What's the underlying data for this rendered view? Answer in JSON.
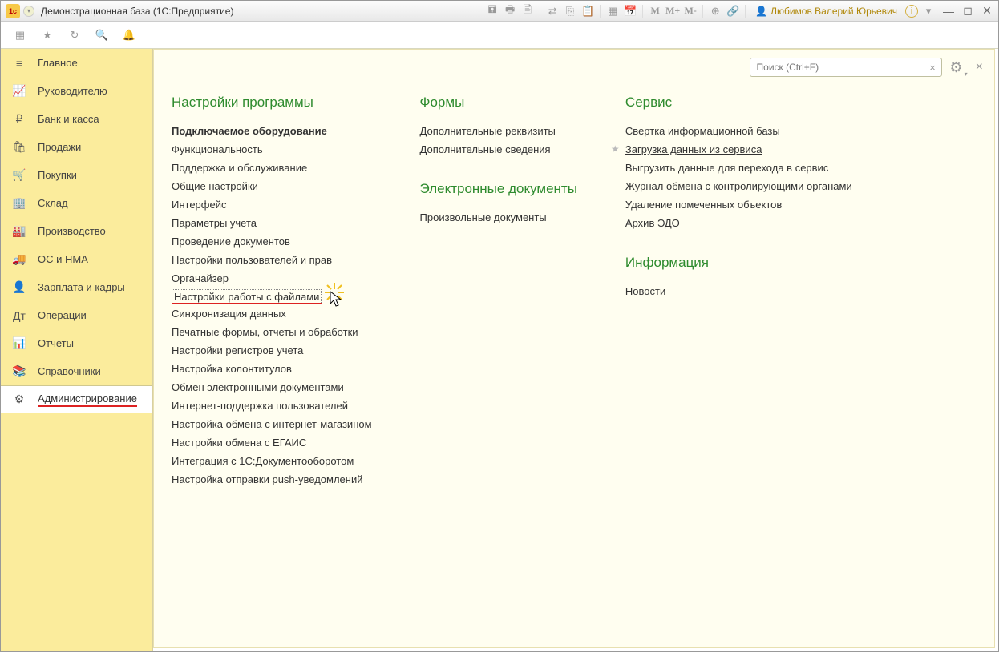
{
  "title": "Демонстрационная база  (1С:Предприятие)",
  "user": "Любимов Валерий Юрьевич",
  "search_placeholder": "Поиск (Ctrl+F)",
  "toolbar": {
    "m1": "M",
    "m2": "M+",
    "m3": "M-"
  },
  "sidebar": {
    "items": [
      {
        "label": "Главное",
        "icon": "≡"
      },
      {
        "label": "Руководителю",
        "icon": "📈"
      },
      {
        "label": "Банк и касса",
        "icon": "₽"
      },
      {
        "label": "Продажи",
        "icon": "🛍"
      },
      {
        "label": "Покупки",
        "icon": "🛒"
      },
      {
        "label": "Склад",
        "icon": "🏢"
      },
      {
        "label": "Производство",
        "icon": "🏭"
      },
      {
        "label": "ОС и НМА",
        "icon": "🚚"
      },
      {
        "label": "Зарплата и кадры",
        "icon": "👤"
      },
      {
        "label": "Операции",
        "icon": "Дт"
      },
      {
        "label": "Отчеты",
        "icon": "📊"
      },
      {
        "label": "Справочники",
        "icon": "📚"
      },
      {
        "label": "Администрирование",
        "icon": "⚙"
      }
    ],
    "active_index": 12
  },
  "columns": [
    {
      "heading": "Настройки программы",
      "items": [
        {
          "label": "Подключаемое оборудование",
          "bold": true
        },
        {
          "label": "Функциональность"
        },
        {
          "label": "Поддержка и обслуживание"
        },
        {
          "label": "Общие настройки"
        },
        {
          "label": "Интерфейс"
        },
        {
          "label": "Параметры учета"
        },
        {
          "label": "Проведение документов"
        },
        {
          "label": "Настройки пользователей и прав"
        },
        {
          "label": "Органайзер"
        },
        {
          "label": "Настройки работы с файлами",
          "highlight": true
        },
        {
          "label": "Синхронизация данных"
        },
        {
          "label": "Печатные формы, отчеты и обработки"
        },
        {
          "label": "Настройки регистров учета"
        },
        {
          "label": "Настройка колонтитулов"
        },
        {
          "label": "Обмен электронными документами"
        },
        {
          "label": "Интернет-поддержка пользователей"
        },
        {
          "label": "Настройка обмена с интернет-магазином"
        },
        {
          "label": "Настройки обмена с ЕГАИС"
        },
        {
          "label": "Интеграция с 1С:Документооборотом"
        },
        {
          "label": "Настройка отправки push-уведомлений"
        }
      ]
    },
    {
      "heading": "Формы",
      "items": [
        {
          "label": "Дополнительные реквизиты"
        },
        {
          "label": "Дополнительные сведения"
        }
      ],
      "heading2": "Электронные документы",
      "items2": [
        {
          "label": "Произвольные документы"
        }
      ]
    },
    {
      "heading": "Сервис",
      "items": [
        {
          "label": "Свертка информационной базы"
        },
        {
          "label": "Загрузка данных из сервиса",
          "starred": true
        },
        {
          "label": "Выгрузить данные для перехода в сервис"
        },
        {
          "label": "Журнал обмена с контролирующими органами"
        },
        {
          "label": "Удаление помеченных объектов"
        },
        {
          "label": "Архив ЭДО"
        }
      ],
      "heading2": "Информация",
      "items2": [
        {
          "label": "Новости"
        }
      ]
    }
  ]
}
